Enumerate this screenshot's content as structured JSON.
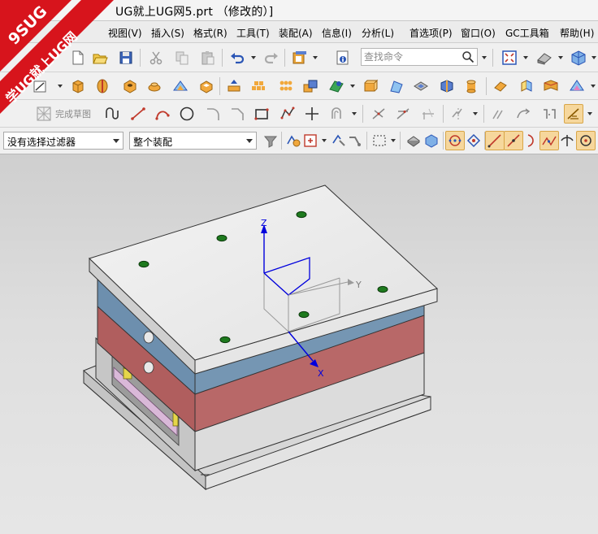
{
  "window": {
    "title": "UG就上UG网5.prt （修改的）]"
  },
  "watermark": {
    "top_text": "9SUG",
    "bottom_text": "学UG就上UG网",
    "color": "#d7141c"
  },
  "menu": {
    "items": [
      "视图(V)",
      "插入(S)",
      "格式(R)",
      "工具(T)",
      "装配(A)",
      "信息(I)",
      "分析(L)",
      "首选项(P)",
      "窗口(O)",
      "GC工具箱",
      "帮助(H)"
    ]
  },
  "command_search": {
    "placeholder": "查找命令"
  },
  "sketch": {
    "finish_label": "完成草图"
  },
  "selection_bar": {
    "filter_value": "没有选择过滤器",
    "scope_value": "整个装配"
  },
  "model": {
    "axis_labels": {
      "x": "X",
      "y": "Y",
      "z": "Z"
    },
    "colors": {
      "top_plate": "#ececec",
      "cavity_plate": "#6d8fae",
      "core_plate": "#b36565",
      "support_block": "#c6c6c6",
      "marker": "#1e7a1e",
      "csys": "#0000dd",
      "datum_plane": "#9a9a9a"
    }
  },
  "theme": {
    "active_button": "#f6d79c",
    "toolbar_bg": "#f0f0f0"
  }
}
